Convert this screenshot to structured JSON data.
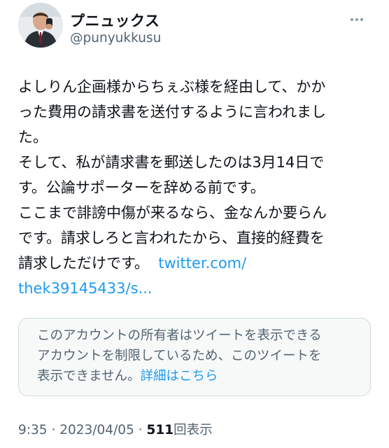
{
  "author": {
    "display_name": "プニュックス",
    "handle": "@punyukkusu",
    "avatar_icon": "user-avatar-icon"
  },
  "tweet": {
    "lines": [
      "よしりん企画様からちぇぶ様を経由して、かか",
      "った費用の請求書を送付するように言われまし",
      "た。",
      "そして、私が請求書を郵送したのは3月14日で",
      "す。公論サポーターを辞める前です。",
      "ここまで誹謗中傷が来るなら、金なんか要らん",
      "です。請求しろと言われたから、直接的経費を"
    ],
    "last_line_text": "請求しただけです。",
    "link_line1": "twitter.com/",
    "link_line2": "thek39145433/s..."
  },
  "withheld_notice": {
    "line1": "このアカウントの所有者はツイートを表示できる",
    "line2": "アカウントを制限しているため、このツイートを",
    "line3": "表示できません。",
    "details_link": "詳細はこちら"
  },
  "meta": {
    "time": "9:35",
    "separator": "·",
    "date": "2023/04/05",
    "view_count": "511",
    "view_label": "回表示"
  },
  "colors": {
    "link": "#1d9bf0",
    "secondary_text": "#536471",
    "primary_text": "#0f1419",
    "notice_bg": "#f7f9f9"
  }
}
